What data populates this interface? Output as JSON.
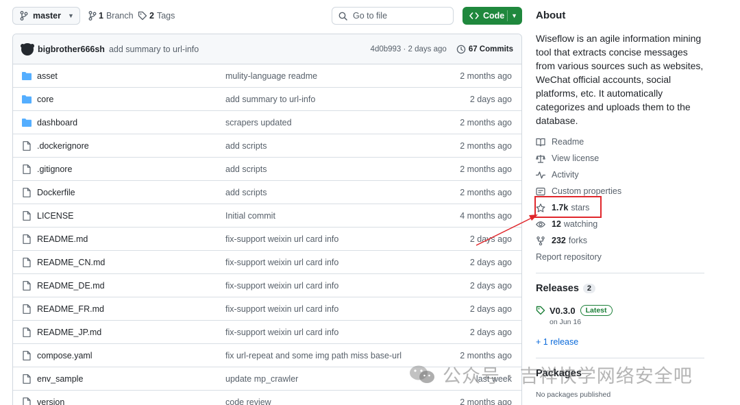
{
  "topbar": {
    "branch": "master",
    "branches_count": "1",
    "branches_label": "Branch",
    "tags_count": "2",
    "tags_label": "Tags",
    "goto_placeholder": "Go to file",
    "code_label": "Code"
  },
  "commit": {
    "author": "bigbrother666sh",
    "message": "add summary to url-info",
    "hash_time": "4d0b993 · 2 days ago",
    "commits_label": "67 Commits"
  },
  "files": [
    {
      "type": "dir",
      "name": "asset",
      "message": "mulity-language readme",
      "date": "2 months ago"
    },
    {
      "type": "dir",
      "name": "core",
      "message": "add summary to url-info",
      "date": "2 days ago"
    },
    {
      "type": "dir",
      "name": "dashboard",
      "message": "scrapers updated",
      "date": "2 months ago"
    },
    {
      "type": "file",
      "name": ".dockerignore",
      "message": "add scripts",
      "date": "2 months ago"
    },
    {
      "type": "file",
      "name": ".gitignore",
      "message": "add scripts",
      "date": "2 months ago"
    },
    {
      "type": "file",
      "name": "Dockerfile",
      "message": "add scripts",
      "date": "2 months ago"
    },
    {
      "type": "file",
      "name": "LICENSE",
      "message": "Initial commit",
      "date": "4 months ago"
    },
    {
      "type": "file",
      "name": "README.md",
      "message": "fix-support weixin url card info",
      "date": "2 days ago"
    },
    {
      "type": "file",
      "name": "README_CN.md",
      "message": "fix-support weixin url card info",
      "date": "2 days ago"
    },
    {
      "type": "file",
      "name": "README_DE.md",
      "message": "fix-support weixin url card info",
      "date": "2 days ago"
    },
    {
      "type": "file",
      "name": "README_FR.md",
      "message": "fix-support weixin url card info",
      "date": "2 days ago"
    },
    {
      "type": "file",
      "name": "README_JP.md",
      "message": "fix-support weixin url card info",
      "date": "2 days ago"
    },
    {
      "type": "file",
      "name": "compose.yaml",
      "message": "fix url-repeat and some img path miss base-url",
      "date": "2 months ago"
    },
    {
      "type": "file",
      "name": "env_sample",
      "message": "update mp_crawler",
      "date": "last week"
    },
    {
      "type": "file",
      "name": "version",
      "message": "code review",
      "date": "2 months ago"
    }
  ],
  "about": {
    "title": "About",
    "description": "Wiseflow is an agile information mining tool that extracts concise messages from various sources such as websites, WeChat official accounts, social platforms, etc. It automatically categorizes and uploads them to the database.",
    "readme": "Readme",
    "license": "View license",
    "activity": "Activity",
    "custom_properties": "Custom properties",
    "stars_count": "1.7k",
    "stars_label": "stars",
    "watching_count": "12",
    "watching_label": "watching",
    "forks_count": "232",
    "forks_label": "forks",
    "report": "Report repository"
  },
  "releases": {
    "title": "Releases",
    "count": "2",
    "version": "V0.3.0",
    "latest_label": "Latest",
    "date": "on Jun 16",
    "more": "+ 1 release"
  },
  "packages": {
    "title": "Packages",
    "none": "No packages published"
  },
  "watermark": {
    "text": "公众号 · 吉祥快学网络安全吧"
  },
  "colors": {
    "code_button": "#1f883d",
    "folder": "#54aeff",
    "link": "#0969da",
    "annotation": "#e0262b"
  }
}
